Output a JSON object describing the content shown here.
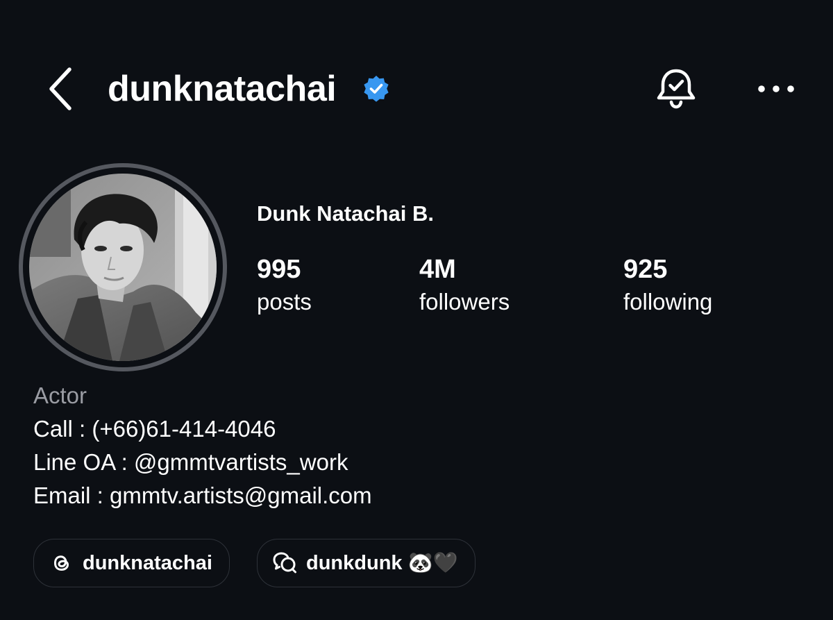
{
  "header": {
    "username": "dunknatachai",
    "back_icon": "chevron-left-icon",
    "verified_icon": "verified-badge-icon",
    "notification_icon": "bell-check-icon",
    "more_icon": "more-horizontal-icon",
    "verified_color": "#3897f0"
  },
  "profile": {
    "full_name": "Dunk Natachai B.",
    "avatar": "profile-photo",
    "stats": [
      {
        "value": "995",
        "label": "posts"
      },
      {
        "value": "4M",
        "label": "followers"
      },
      {
        "value": "925",
        "label": "following"
      }
    ]
  },
  "bio": {
    "category": "Actor",
    "lines": [
      "Call : (+66)61-414-4046",
      "Line OA : @gmmtvartists_work",
      "Email : gmmtv.artists@gmail.com"
    ]
  },
  "chips": [
    {
      "icon": "threads-icon",
      "label": "dunknatachai"
    },
    {
      "icon": "chat-bubbles-icon",
      "label": "dunkdunk 🐼🖤"
    }
  ],
  "colors": {
    "background": "#0c0f14",
    "text": "#ffffff",
    "muted": "#9a9ca3",
    "ring": "#55585f"
  }
}
